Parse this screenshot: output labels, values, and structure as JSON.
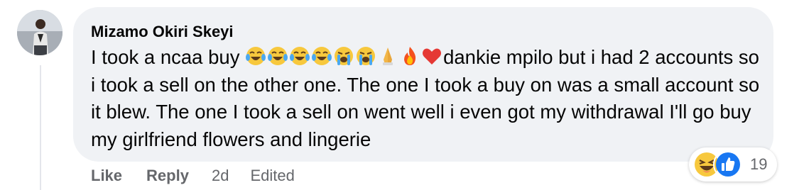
{
  "comment": {
    "author": "Mizamo Okiri Skeyi",
    "text_before_emoji": "I took a ncaa buy ",
    "emoji_sequence": [
      "laughing-crying",
      "laughing-crying",
      "laughing-crying",
      "laughing-crying",
      "loudly-crying",
      "loudly-crying",
      "praying-hands",
      "fire",
      "red-heart"
    ],
    "text_after_emoji": "dankie mpilo but i had 2 accounts so i took a sell on the other one. The one I took a buy on was a small account so it blew. The one I took a sell on went well i even got my withdrawal I'll go buy my girlfriend flowers and lingerie"
  },
  "reactions": {
    "icons": [
      "haha-reaction-icon",
      "like-reaction-icon"
    ],
    "count": "19"
  },
  "actions": {
    "like_label": "Like",
    "reply_label": "Reply",
    "timestamp": "2d",
    "edited_label": "Edited"
  },
  "colors": {
    "bubble_bg": "#f0f2f5",
    "text": "#050505",
    "muted": "#65676b",
    "like_blue": "#1877f2",
    "haha_yellow": "#f7c83d"
  }
}
